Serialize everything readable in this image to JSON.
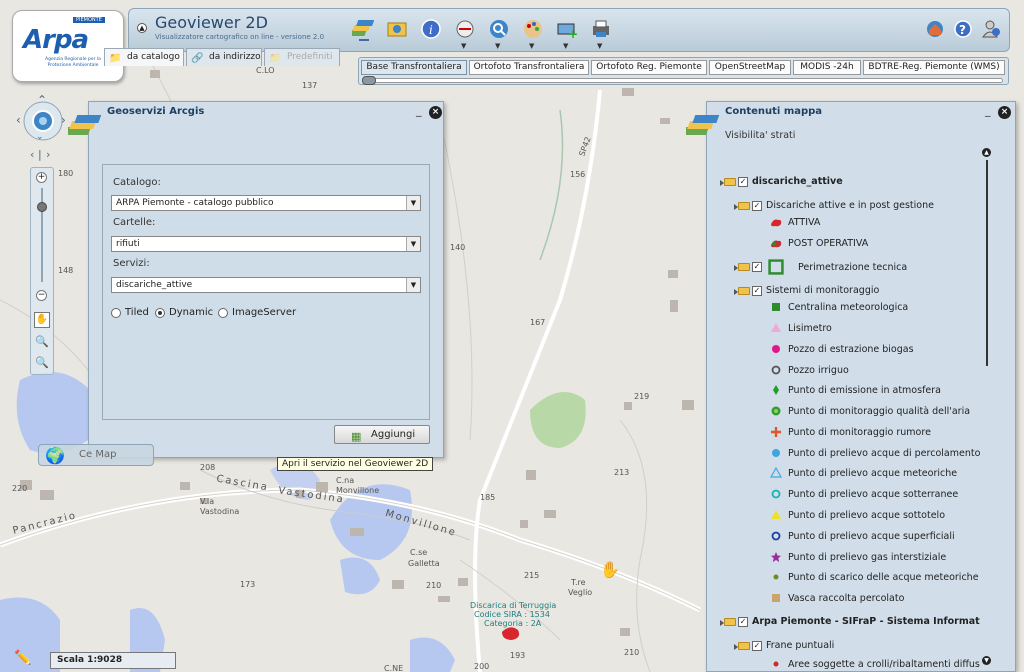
{
  "app": {
    "title": "Geoviewer 2D",
    "subtitle": "Visualizzatore cartografico on line - versione 2.0",
    "logo_word": "Arpa",
    "logo_tag": "PIEMONTE",
    "logo_sub": "Agenzia Regionale per la Protezione Ambientale"
  },
  "toolbar": {
    "icons": [
      "layers-icon",
      "map-tools-icon",
      "info-icon",
      "measure-icon",
      "search-icon",
      "palette-icon",
      "add-layer-icon",
      "print-icon"
    ],
    "right_icons": [
      "home-map-icon",
      "help-icon",
      "user-info-icon"
    ]
  },
  "base_layers": {
    "tabs": [
      "Base Transfrontaliera",
      "Ortofoto Transfrontaliera",
      "Ortofoto Reg. Piemonte",
      "OpenStreetMap",
      "MODIS -24h",
      "BDTRE-Reg. Piemonte (WMS)"
    ],
    "selected": "Base Transfrontaliera"
  },
  "arcgis_panel": {
    "title": "Geoservizi Arcgis",
    "tabs": [
      {
        "label": "da catalogo",
        "state": "active"
      },
      {
        "label": "da indirizzo",
        "state": "normal"
      },
      {
        "label": "Predefiniti",
        "state": "disabled"
      }
    ],
    "catalog_label": "Catalogo:",
    "catalog_value": "ARPA Piemonte - catalogo pubblico",
    "folders_label": "Cartelle:",
    "folders_value": "rifiuti",
    "services_label": "Servizi:",
    "services_value": "discariche_attive",
    "radios": [
      {
        "label": "Tiled",
        "checked": false
      },
      {
        "label": "Dynamic",
        "checked": true
      },
      {
        "label": "ImageServer",
        "checked": false
      }
    ],
    "add_button": "Aggiungi",
    "tooltip": "Apri il servizio nel Geoviewer 2D"
  },
  "contents_panel": {
    "title": "Contenuti mappa",
    "visibility_label": "Visibilita' strati",
    "tree": [
      {
        "label": "discariche_attive",
        "level": 0,
        "bold": true,
        "folder": true,
        "checked": true
      },
      {
        "label": "Discariche attive e in post gestione",
        "level": 1,
        "folder": true,
        "checked": true
      },
      {
        "label": "ATTIVA",
        "level": 2,
        "symbol": "red-blob",
        "color": "#d8262c"
      },
      {
        "label": "POST OPERATIVA",
        "level": 2,
        "symbol": "red-green-blob",
        "color": "#c43030"
      },
      {
        "label": "Perimetrazione tecnica",
        "level": 1,
        "folder": true,
        "checked": true,
        "symbol": "green-square-outline",
        "color": "#2e8b2e"
      },
      {
        "label": "Sistemi di monitoraggio",
        "level": 1,
        "folder": true,
        "checked": true
      },
      {
        "label": "Centralina meteorologica",
        "level": 2,
        "symbol": "square",
        "color": "#2e8b2e"
      },
      {
        "label": "Lisimetro",
        "level": 2,
        "symbol": "triangle",
        "color": "#f3a6d8"
      },
      {
        "label": "Pozzo di estrazione biogas",
        "level": 2,
        "symbol": "circle",
        "color": "#e4148b"
      },
      {
        "label": "Pozzo irriguo",
        "level": 2,
        "symbol": "ring",
        "color": "#555555"
      },
      {
        "label": "Punto di emissione in atmosfera",
        "level": 2,
        "symbol": "diamond",
        "color": "#1f9e2a"
      },
      {
        "label": "Punto di monitoraggio qualità dell'aria",
        "level": 2,
        "symbol": "flower",
        "color": "#2e9e2e"
      },
      {
        "label": "Punto di monitoraggio rumore",
        "level": 2,
        "symbol": "cross",
        "color": "#e0542a"
      },
      {
        "label": "Punto di prelievo acque di percolamento",
        "level": 2,
        "symbol": "circle",
        "color": "#3fa7e0"
      },
      {
        "label": "Punto di prelievo acque meteoriche",
        "level": 2,
        "symbol": "triangle-outline",
        "color": "#3fa7e0"
      },
      {
        "label": "Punto di prelievo acque sotterranee",
        "level": 2,
        "symbol": "ring",
        "color": "#16b3b3"
      },
      {
        "label": "Punto di prelievo acque sottotelo",
        "level": 2,
        "symbol": "triangle",
        "color": "#f0e02a"
      },
      {
        "label": "Punto di prelievo acque superficiali",
        "level": 2,
        "symbol": "ring",
        "color": "#1a3f9e"
      },
      {
        "label": "Punto di prelievo gas interstiziale",
        "level": 2,
        "symbol": "star",
        "color": "#9b2c9b"
      },
      {
        "label": "Punto di scarico delle acque meteoriche",
        "level": 2,
        "symbol": "dot",
        "color": "#6b8e23"
      },
      {
        "label": "Vasca raccolta percolato",
        "level": 2,
        "symbol": "square",
        "color": "#c9a56b"
      },
      {
        "label": "Arpa Piemonte - SIFraP - Sistema Informativo Fra",
        "level": 0,
        "bold": true,
        "folder": true,
        "checked": true
      },
      {
        "label": "Frane puntuali",
        "level": 1,
        "folder": true,
        "checked": true
      },
      {
        "label": "Aree soggette a crolli/ribaltamenti diffusi",
        "level": 2,
        "symbol": "dot",
        "color": "#d82626"
      }
    ]
  },
  "map": {
    "labels": [
      "C.LO",
      "137",
      "SP42",
      "156",
      "180",
      "148",
      "140",
      "167",
      "219",
      "213",
      "185",
      "208",
      "220",
      "Cascina",
      "Vastodina",
      "Pancrazio",
      "V.la",
      "Vastodina",
      "C.na",
      "Monvillone",
      "Monvillone",
      "C.se",
      "Galletta",
      "210",
      "215",
      "T.re",
      "Veglio",
      "173",
      "193",
      "210",
      "200",
      "C.NE",
      "Discarica di Terruggia",
      "Codice SIRA : 1534",
      "Categoria : 2A"
    ],
    "overlay_label": "Ce Map"
  },
  "scale": "Scala 1:9028",
  "colors": {
    "panel": "#cfdee9",
    "accent": "#1f3f62",
    "water": "#b6c7f0",
    "forest": "#b8d8a8"
  }
}
